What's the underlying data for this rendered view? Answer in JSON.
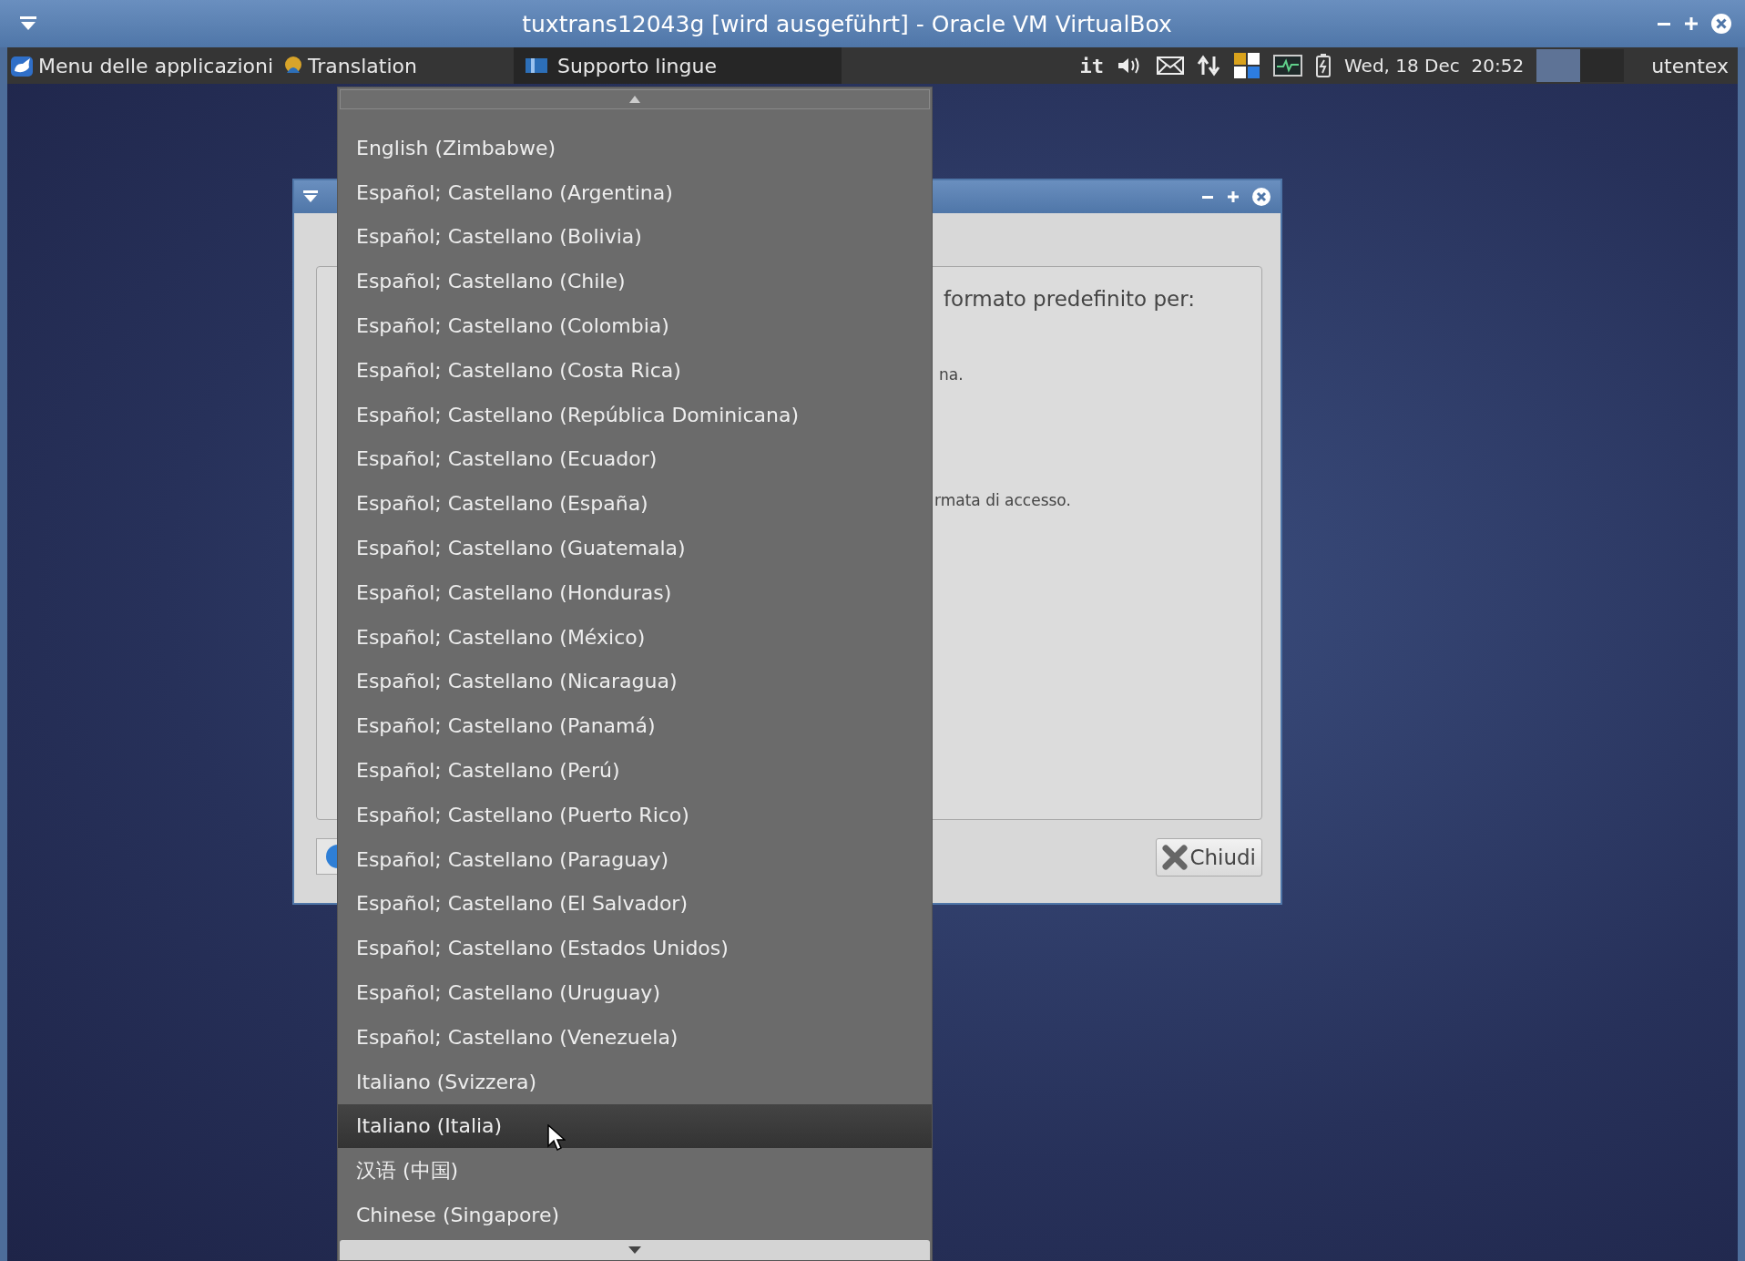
{
  "window": {
    "title": "tuxtrans12043g [wird ausgeführt] - Oracle VM VirtualBox"
  },
  "panel": {
    "launchers": [
      {
        "kind": "appmenu",
        "label": "Menu delle applicazioni"
      },
      {
        "kind": "translation",
        "label": "Translation"
      }
    ],
    "task": {
      "label": "Supporto lingue"
    },
    "keyboard_layout": "it",
    "clock": "Wed, 18 Dec  20:52",
    "workspaces": [
      {
        "selected": true
      },
      {
        "selected": false
      }
    ],
    "user": "utentex"
  },
  "dialog": {
    "texts": [
      "formato predefinito per:",
      "na.",
      "rmata di accesso."
    ],
    "close_button": "Chiudi"
  },
  "menu": {
    "items": [
      {
        "label": "English (Zimbabwe)",
        "selected": false
      },
      {
        "label": "Español; Castellano (Argentina)",
        "selected": false
      },
      {
        "label": "Español; Castellano (Bolivia)",
        "selected": false
      },
      {
        "label": "Español; Castellano (Chile)",
        "selected": false
      },
      {
        "label": "Español; Castellano (Colombia)",
        "selected": false
      },
      {
        "label": "Español; Castellano (Costa Rica)",
        "selected": false
      },
      {
        "label": "Español; Castellano (República Dominicana)",
        "selected": false
      },
      {
        "label": "Español; Castellano (Ecuador)",
        "selected": false
      },
      {
        "label": "Español; Castellano (España)",
        "selected": false
      },
      {
        "label": "Español; Castellano (Guatemala)",
        "selected": false
      },
      {
        "label": "Español; Castellano (Honduras)",
        "selected": false
      },
      {
        "label": "Español; Castellano (México)",
        "selected": false
      },
      {
        "label": "Español; Castellano (Nicaragua)",
        "selected": false
      },
      {
        "label": "Español; Castellano (Panamá)",
        "selected": false
      },
      {
        "label": "Español; Castellano (Perú)",
        "selected": false
      },
      {
        "label": "Español; Castellano (Puerto Rico)",
        "selected": false
      },
      {
        "label": "Español; Castellano (Paraguay)",
        "selected": false
      },
      {
        "label": "Español; Castellano (El Salvador)",
        "selected": false
      },
      {
        "label": "Español; Castellano (Estados Unidos)",
        "selected": false
      },
      {
        "label": "Español; Castellano (Uruguay)",
        "selected": false
      },
      {
        "label": "Español; Castellano (Venezuela)",
        "selected": false
      },
      {
        "label": "Italiano (Svizzera)",
        "selected": false
      },
      {
        "label": "Italiano (Italia)",
        "selected": true
      },
      {
        "label": "汉语 (中国)",
        "selected": false
      },
      {
        "label": "Chinese (Singapore)",
        "selected": false
      }
    ]
  }
}
